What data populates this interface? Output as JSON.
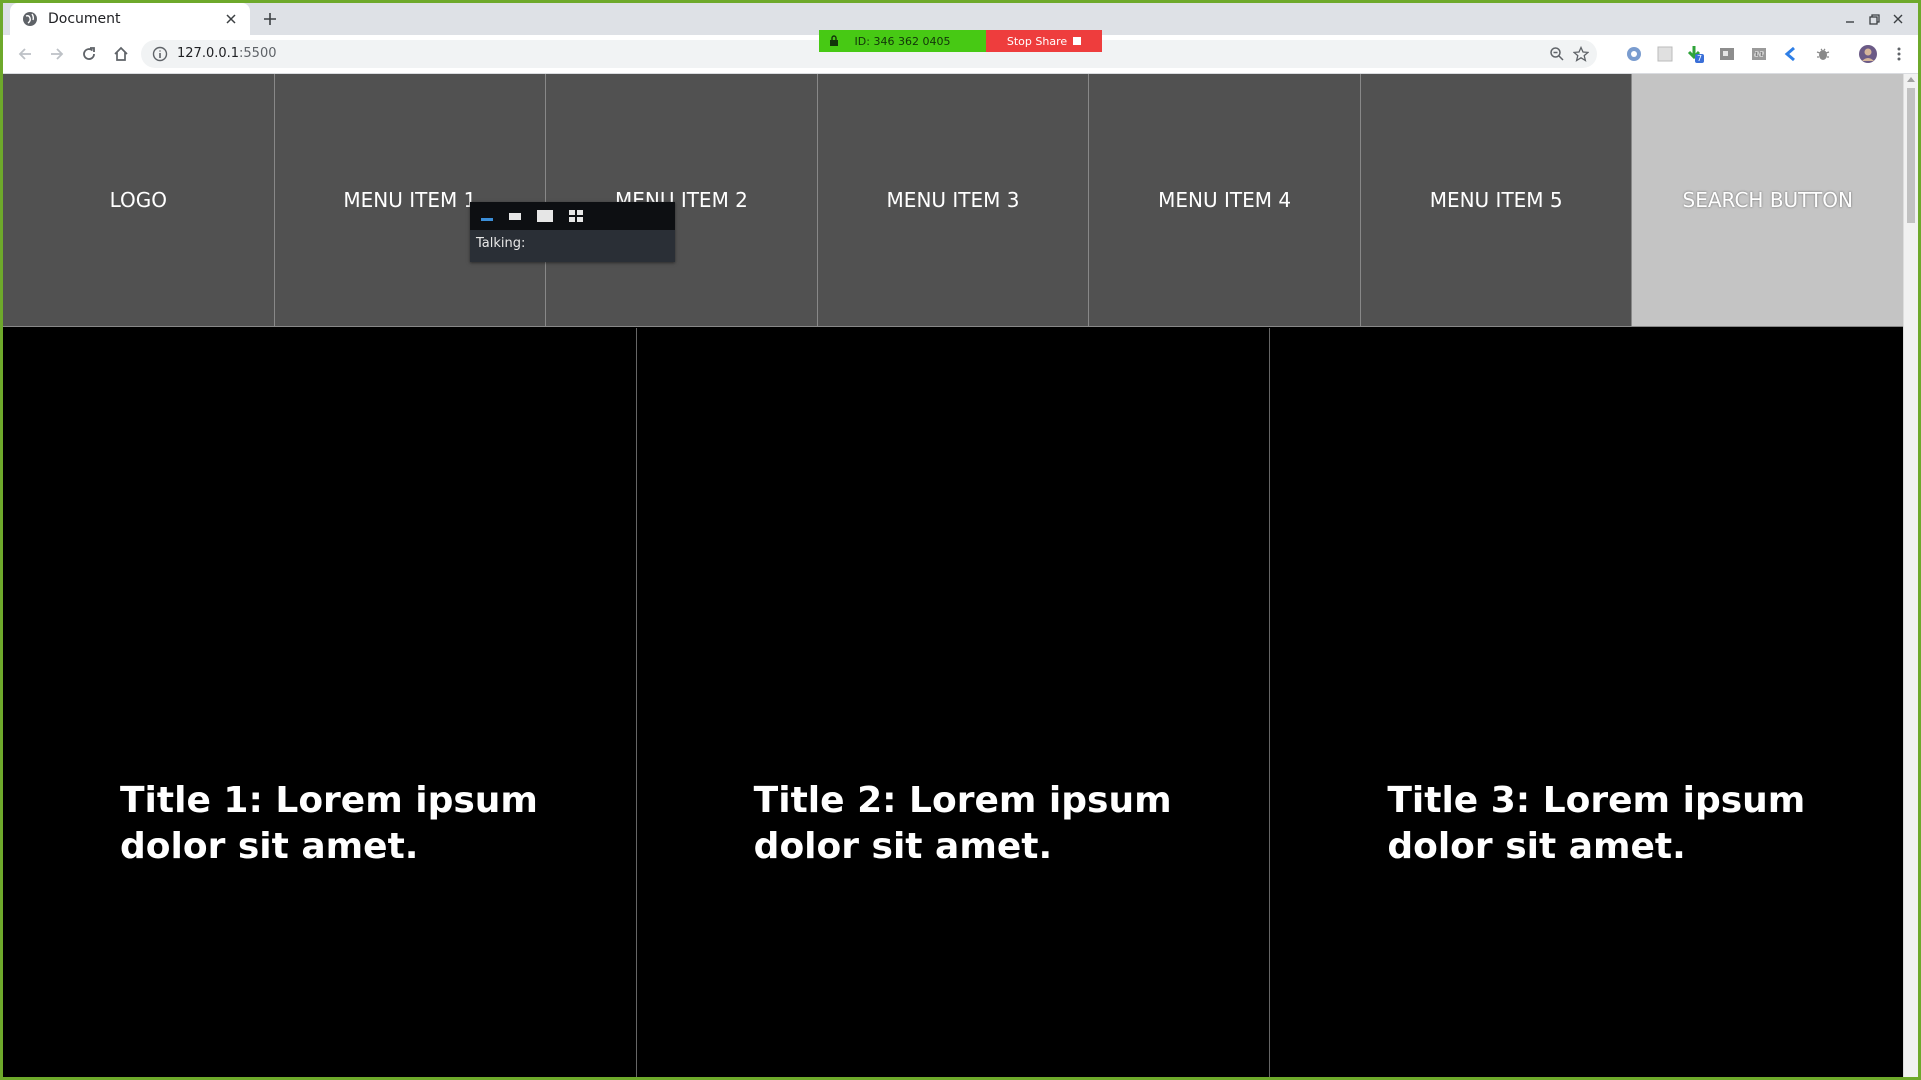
{
  "browser": {
    "tab_title": "Document",
    "url_host": "127.0.0.1",
    "url_port": ":5500"
  },
  "screen_share": {
    "id_label": "ID: 346 362 0405",
    "stop_label": "Stop Share",
    "id_color": "#47c914",
    "stop_color": "#ee3d3d"
  },
  "talk_widget": {
    "label": "Talking:"
  },
  "menu": {
    "items": [
      "LOGO",
      "MENU ITEM 1",
      "MENU ITEM 2",
      "MENU ITEM 3",
      "MENU ITEM 4",
      "MENU ITEM 5",
      "SEARCH BUTTON"
    ]
  },
  "cards": [
    {
      "title": "Title 1: Lorem ipsum dolor sit amet."
    },
    {
      "title": "Title 2: Lorem ipsum dolor sit amet."
    },
    {
      "title": "Title 3: Lorem ipsum dolor sit amet."
    }
  ],
  "extension_badge": "7"
}
